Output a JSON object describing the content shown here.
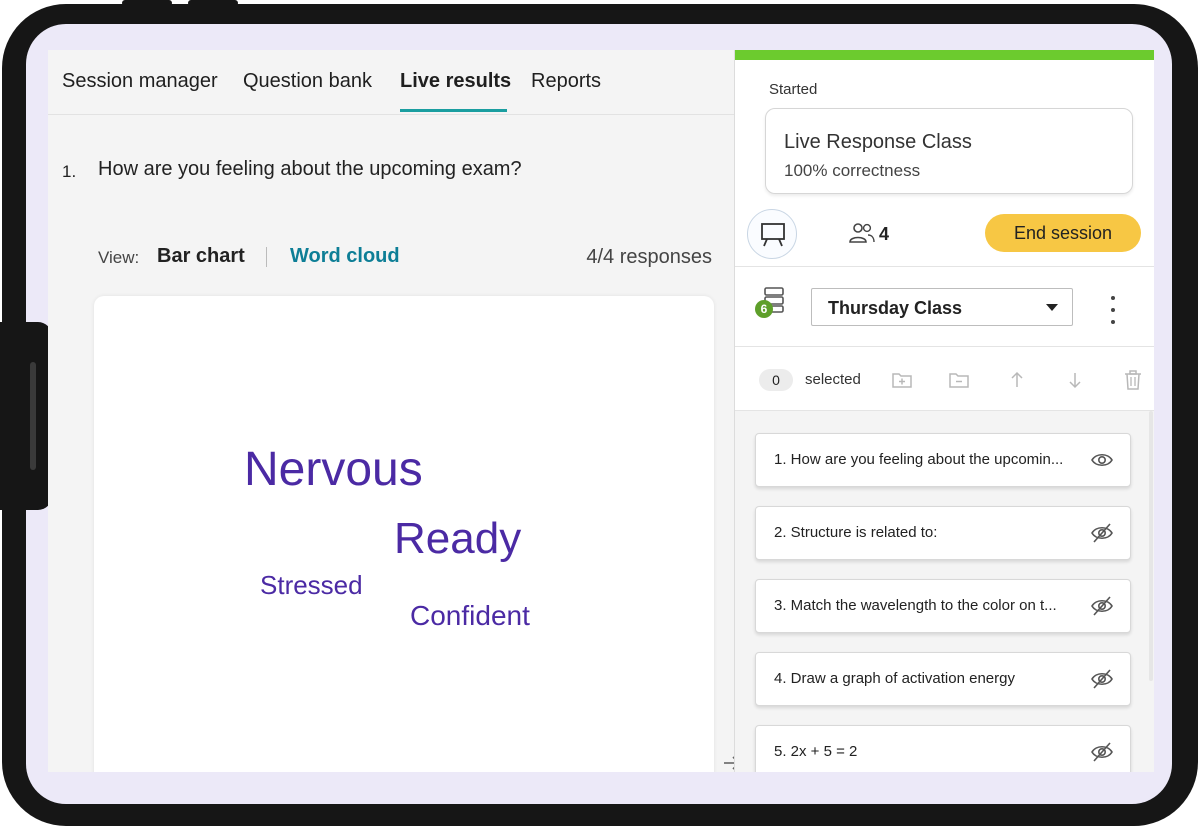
{
  "tabs": [
    {
      "label": "Session manager",
      "active": false
    },
    {
      "label": "Question bank",
      "active": false
    },
    {
      "label": "Live results",
      "active": true
    },
    {
      "label": "Reports",
      "active": false
    }
  ],
  "question": {
    "number": "1.",
    "text": "How are you feeling about the upcoming exam?"
  },
  "view": {
    "label": "View:",
    "bar_chart": "Bar chart",
    "word_cloud": "Word cloud",
    "responses": "4/4 responses"
  },
  "word_cloud": [
    {
      "word": "Nervous"
    },
    {
      "word": "Ready"
    },
    {
      "word": "Stressed"
    },
    {
      "word": "Confident"
    }
  ],
  "session": {
    "status": "Started",
    "name": "Live Response Class",
    "correctness": "100% correctness",
    "student_count": "4",
    "end_label": "End session"
  },
  "class_select": {
    "badge": "6",
    "selected": "Thursday Class"
  },
  "selection": {
    "count": "0",
    "label": "selected"
  },
  "question_list": [
    {
      "text": "1. How are you feeling about the upcomin...",
      "visible": true
    },
    {
      "text": "2. Structure is related to:",
      "visible": false
    },
    {
      "text": "3. Match the wavelength to the color on t...",
      "visible": false
    },
    {
      "text": "4. Draw a graph of activation energy",
      "visible": false
    },
    {
      "text": "5. 2x + 5 = 2",
      "visible": false
    }
  ],
  "icons": {
    "present": "presentation-board-icon",
    "students": "people-icon",
    "stack": "question-stack-icon",
    "eye_open": "eye-icon",
    "eye_hidden": "eye-slash-icon",
    "collapse": "collapse-panel-icon"
  },
  "colors": {
    "accent_teal": "#1a9ea0",
    "word_cloud_purple": "#4b2aa4",
    "end_button": "#f7c744",
    "started_green": "#6ccb2e"
  }
}
